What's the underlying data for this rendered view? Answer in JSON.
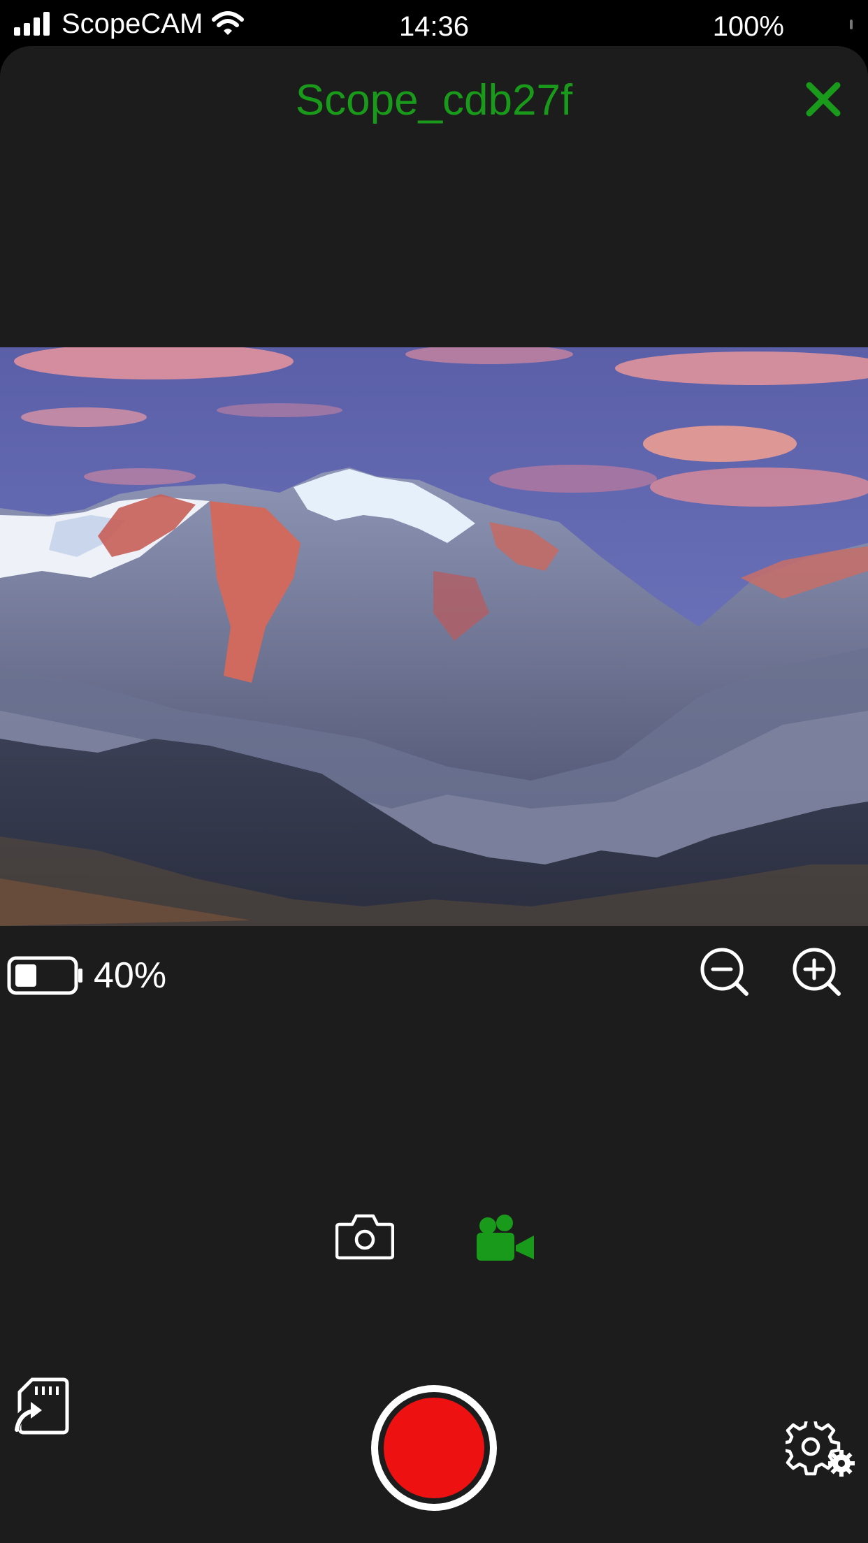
{
  "status_bar": {
    "carrier": "ScopeCAM",
    "time": "14:36",
    "battery": "100%"
  },
  "header": {
    "title": "Scope_cdb27f",
    "close_icon": "close-icon"
  },
  "preview": {
    "description_icon": "camera-preview"
  },
  "device": {
    "battery_label": "40%",
    "battery_level": 0.4
  },
  "controls": {
    "zoom_out_icon": "zoom-out-icon",
    "zoom_in_icon": "zoom-in-icon",
    "modes": [
      {
        "id": "photo",
        "icon": "camera-icon",
        "active": false
      },
      {
        "id": "video",
        "icon": "video-camera-icon",
        "active": true
      }
    ],
    "shutter": {
      "icon": "record-icon"
    },
    "sd_export": {
      "icon": "sd-card-export-icon"
    },
    "settings": {
      "icon": "gear-icon"
    }
  },
  "colors": {
    "accent": "#1a9a1a",
    "record": "#ee1111",
    "background": "#1c1c1c"
  }
}
